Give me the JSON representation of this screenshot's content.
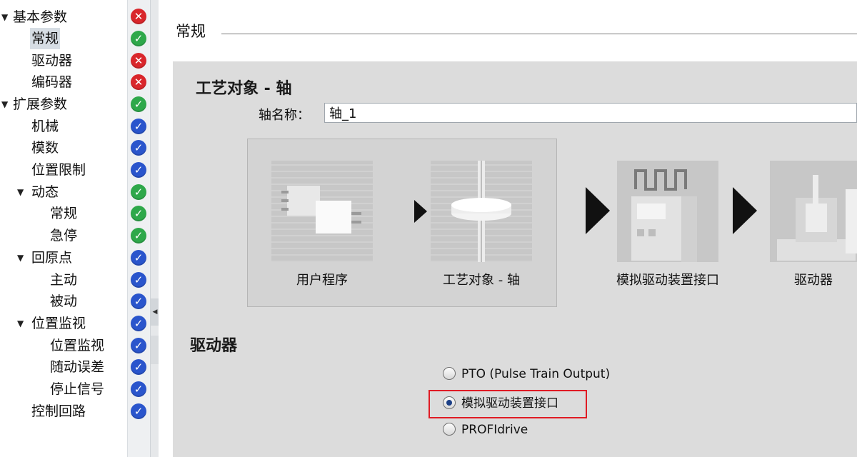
{
  "tree": {
    "items": [
      {
        "label": "基本参数",
        "status": "error"
      },
      {
        "label": "常规",
        "status": "ok"
      },
      {
        "label": "驱动器",
        "status": "error"
      },
      {
        "label": "编码器",
        "status": "error"
      },
      {
        "label": "扩展参数",
        "status": "ok"
      },
      {
        "label": "机械",
        "status": "info"
      },
      {
        "label": "模数",
        "status": "info"
      },
      {
        "label": "位置限制",
        "status": "info"
      },
      {
        "label": "动态",
        "status": "ok"
      },
      {
        "label": "常规",
        "status": "ok"
      },
      {
        "label": "急停",
        "status": "ok"
      },
      {
        "label": "回原点",
        "status": "info"
      },
      {
        "label": "主动",
        "status": "info"
      },
      {
        "label": "被动",
        "status": "info"
      },
      {
        "label": "位置监视",
        "status": "info"
      },
      {
        "label": "位置监视",
        "status": "info"
      },
      {
        "label": "随动误差",
        "status": "info"
      },
      {
        "label": "停止信号",
        "status": "info"
      },
      {
        "label": "控制回路",
        "status": "info"
      }
    ],
    "status_icons": {
      "error": "error-icon",
      "ok": "check-icon",
      "info": "info-check-icon"
    },
    "colors": {
      "error": "#d9262b",
      "ok": "#2ea84a",
      "info": "#2a55cc"
    }
  },
  "main": {
    "section_title": "常规",
    "heading": "工艺对象 - 轴",
    "axis_name_label": "轴名称：",
    "axis_name_value": "轴_1",
    "diagram": {
      "user_program": "用户程序",
      "technology_object": "工艺对象 - 轴",
      "analog_interface": "模拟驱动装置接口",
      "drive": "驱动器"
    },
    "drive_heading": "驱动器",
    "drive_options": [
      {
        "label": "PTO (Pulse Train Output)",
        "selected": false
      },
      {
        "label": "模拟驱动装置接口",
        "selected": true
      },
      {
        "label": "PROFIdrive",
        "selected": false
      }
    ],
    "highlight_color": "#e01b24"
  }
}
